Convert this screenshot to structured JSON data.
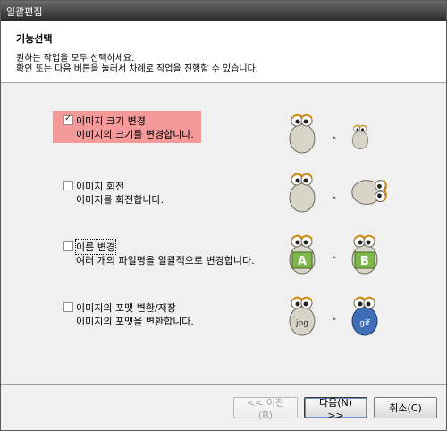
{
  "window": {
    "title": "일괄편집"
  },
  "header": {
    "section_title": "기능선택",
    "desc_line1": "원하는 작업을 모두 선택하세요.",
    "desc_line2": "확인 또는 다음 버튼을 눌러서 차례로 작업을 진행할 수 있습니다."
  },
  "options": [
    {
      "title": "이미지 크기 변경",
      "desc": "이미지의 크기를 변경합니다.",
      "checked": true,
      "from_label": "",
      "to_label": ""
    },
    {
      "title": "이미지 회전",
      "desc": "이미지를 회전합니다.",
      "checked": false,
      "from_label": "",
      "to_label": ""
    },
    {
      "title": "이름 변경",
      "desc": "여러 개의 파일명을 일괄적으로 변경합니다.",
      "checked": false,
      "from_label": "A",
      "to_label": "B"
    },
    {
      "title": "이미지의 포맷 변환/저장",
      "desc": "이미지의 포맷을 변환합니다.",
      "checked": false,
      "from_label": "jpg",
      "to_label": "gif"
    }
  ],
  "arrow_glyph": "▸",
  "buttons": {
    "prev": "<< 이전(B)",
    "next": "다음(N) >>",
    "cancel": "취소(C)"
  },
  "colors": {
    "selected_highlight": "#f49a9a",
    "titlebar": "#3a3a3a"
  }
}
